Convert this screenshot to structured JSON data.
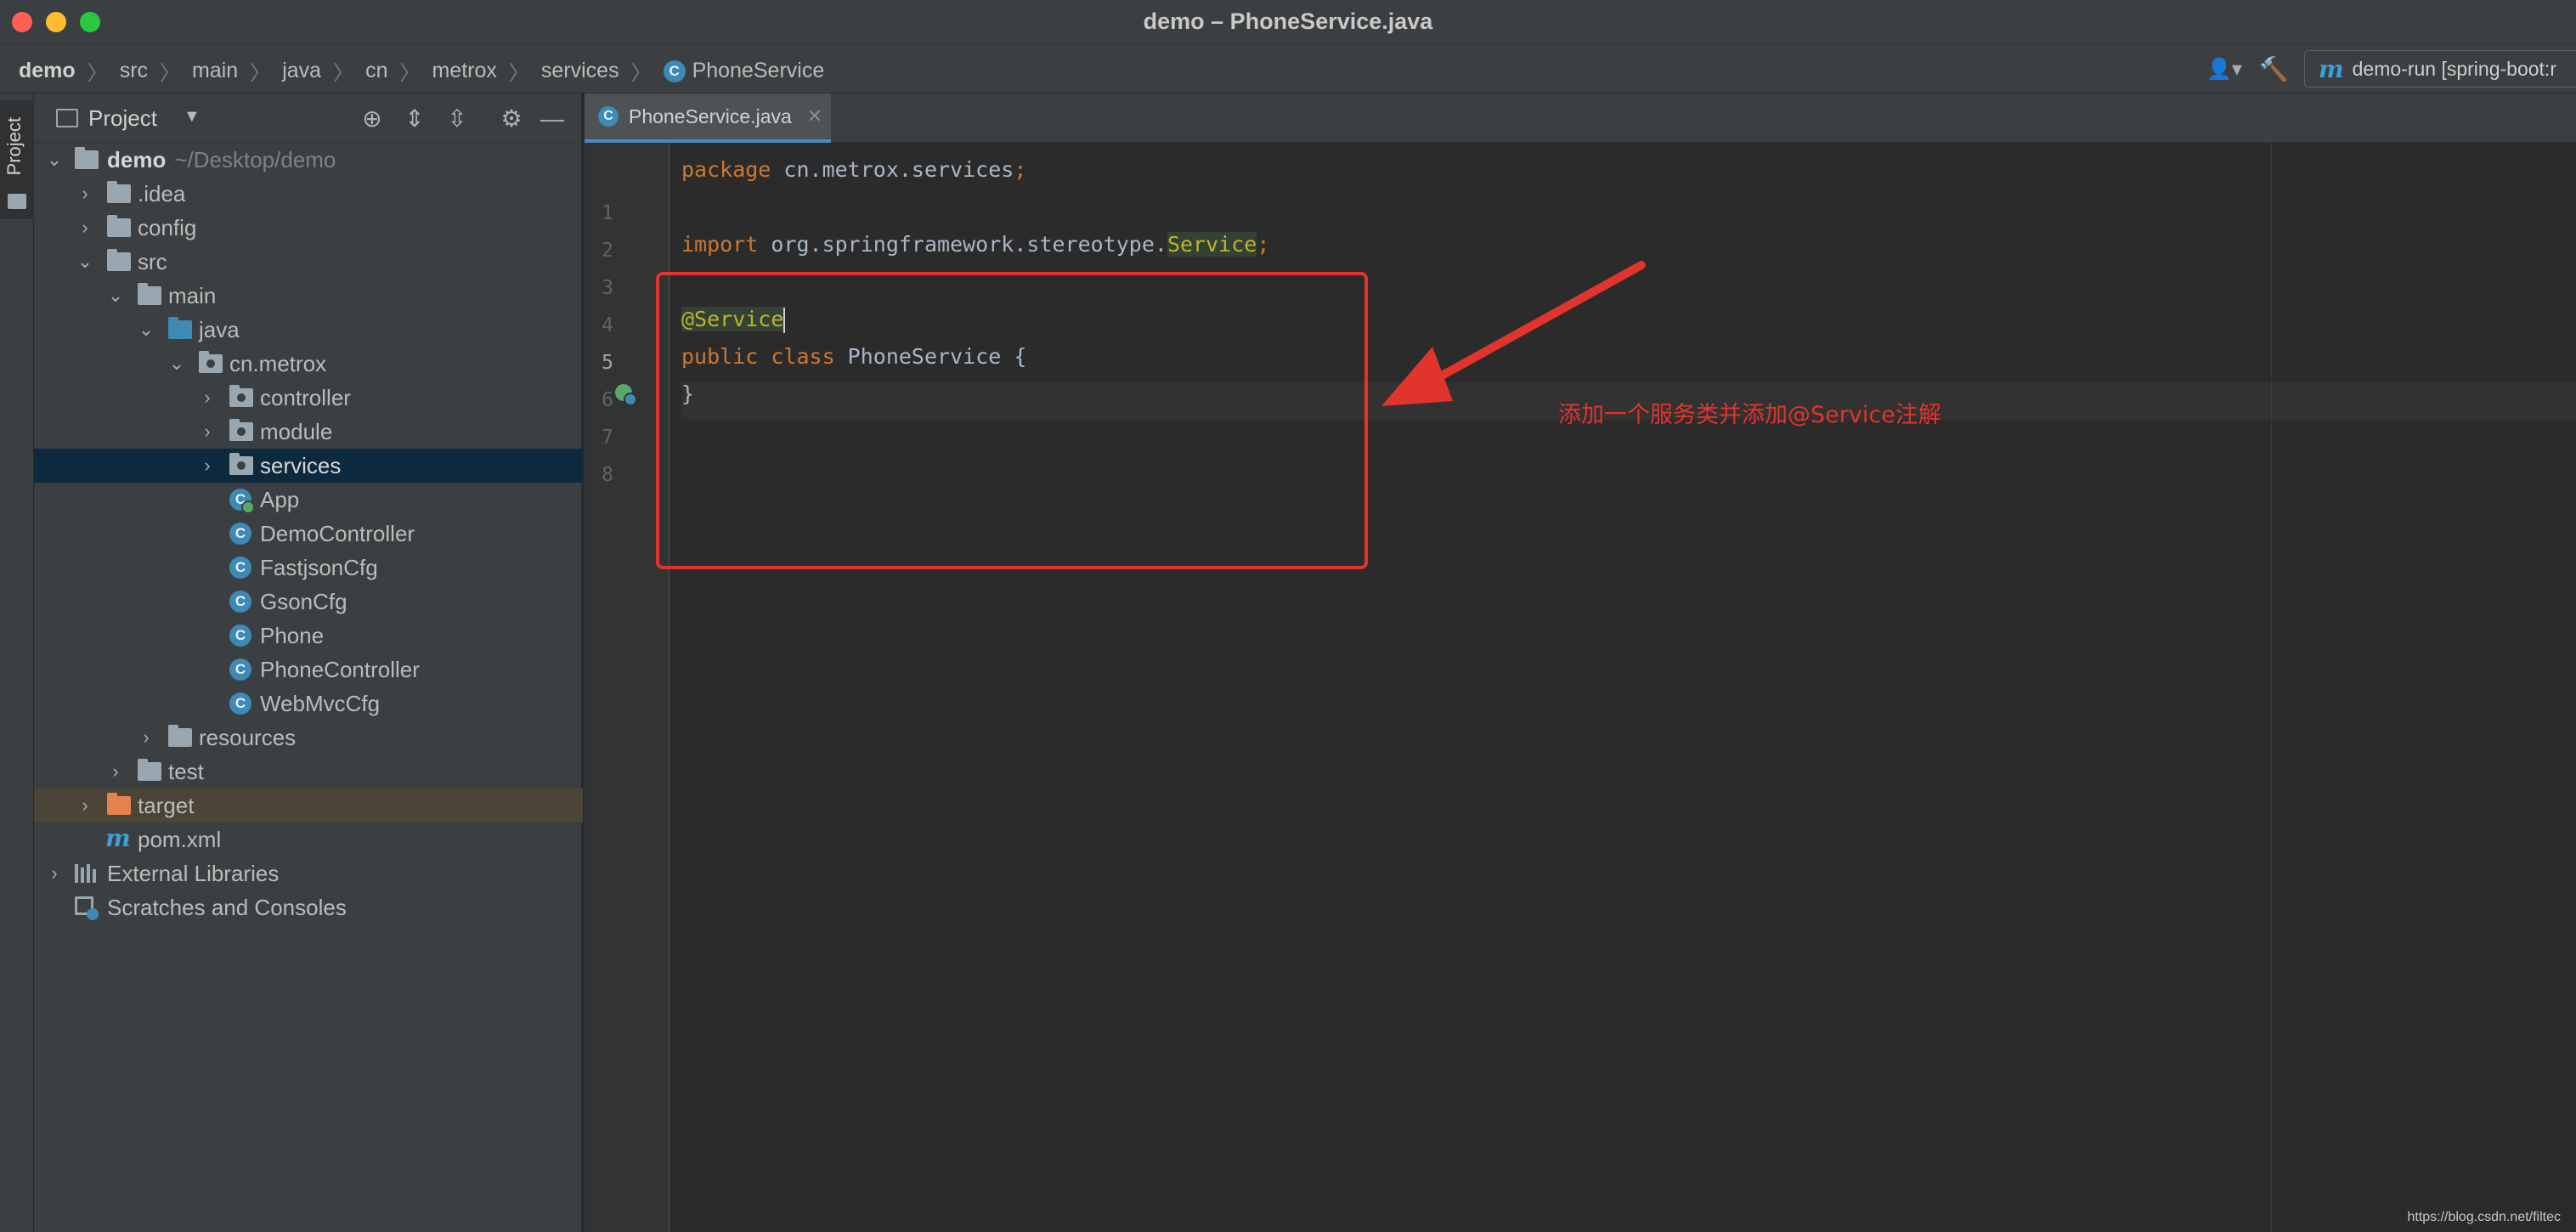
{
  "window": {
    "title": "demo – PhoneService.java"
  },
  "breadcrumb": [
    "demo",
    "src",
    "main",
    "java",
    "cn",
    "metrox",
    "services",
    "PhoneService"
  ],
  "toolbar": {
    "run_config": "demo-run [spring-boot:r"
  },
  "tool_strip": {
    "project_label": "Project"
  },
  "project_panel": {
    "title": "Project",
    "tree": {
      "root": {
        "name": "demo",
        "path": "~/Desktop/demo"
      },
      "idea": ".idea",
      "config": "config",
      "src": "src",
      "main": "main",
      "java": "java",
      "package": "cn.metrox",
      "controller": "controller",
      "module": "module",
      "services": "services",
      "classes": [
        "App",
        "DemoController",
        "FastjsonCfg",
        "GsonCfg",
        "Phone",
        "PhoneController",
        "WebMvcCfg"
      ],
      "resources": "resources",
      "test": "test",
      "target": "target",
      "pom": "pom.xml",
      "external_libraries": "External Libraries",
      "scratches": "Scratches and Consoles"
    }
  },
  "editor": {
    "tab_label": "PhoneService.java",
    "line_numbers": [
      "1",
      "2",
      "3",
      "4",
      "5",
      "6",
      "7",
      "8"
    ],
    "code": {
      "l1_kw": "package",
      "l1_rest": " cn.metrox.services",
      "l1_semi": ";",
      "l3_kw": "import",
      "l3_rest": " org.springframework.stereotype.",
      "l3_cls": "Service",
      "l3_semi": ";",
      "l5_ann": "@Service",
      "l6_kw": "public class",
      "l6_rest": " PhoneService {",
      "l7": "}"
    }
  },
  "annotation": {
    "note": "添加一个服务类并添加@Service注解",
    "color": "#e0342c"
  },
  "watermark": "https://blog.csdn.net/filtec"
}
